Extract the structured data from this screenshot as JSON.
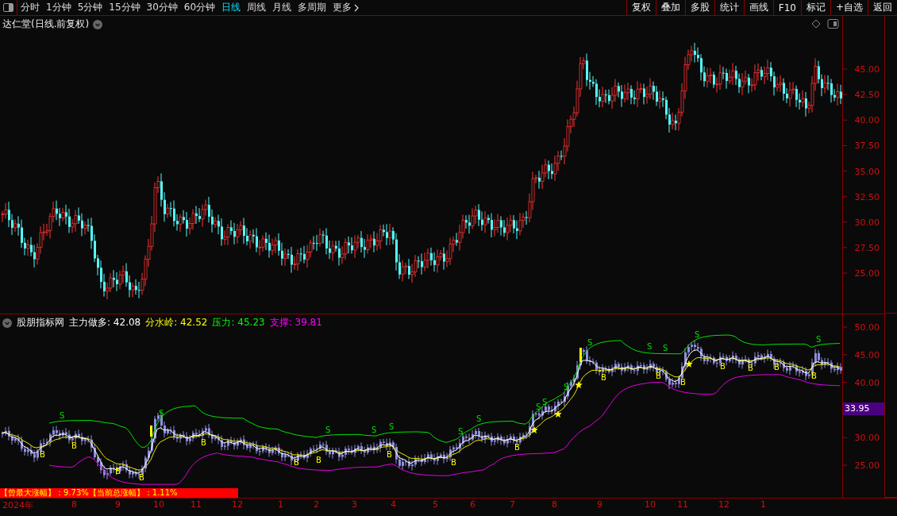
{
  "toolbar": {
    "periods": [
      {
        "label": "分时",
        "selected": false
      },
      {
        "label": "1分钟",
        "selected": false
      },
      {
        "label": "5分钟",
        "selected": false
      },
      {
        "label": "15分钟",
        "selected": false
      },
      {
        "label": "30分钟",
        "selected": false
      },
      {
        "label": "60分钟",
        "selected": false
      },
      {
        "label": "日线",
        "selected": true
      },
      {
        "label": "周线",
        "selected": false
      },
      {
        "label": "月线",
        "selected": false
      },
      {
        "label": "多周期",
        "selected": false
      }
    ],
    "more": "更多",
    "buttons": [
      "复权",
      "叠加",
      "多股",
      "统计",
      "画线",
      "F10",
      "标记",
      "+自选",
      "返回"
    ]
  },
  "price_pane": {
    "title": "达仁堂(日线.前复权)",
    "axis_ticks": [
      "45.00",
      "42.50",
      "40.00",
      "37.50",
      "35.00",
      "32.50",
      "30.00",
      "27.50",
      "25.00"
    ]
  },
  "indicator_pane": {
    "name": "股朋指标网",
    "readings": [
      {
        "label": "主力做多:",
        "value": "42.08",
        "color": "#ffffff"
      },
      {
        "label": "分水岭:",
        "value": "42.52",
        "color": "#ffff00"
      },
      {
        "label": "压力:",
        "value": "45.23",
        "color": "#00ff00"
      },
      {
        "label": "支撑:",
        "value": "39.81",
        "color": "#ff00ff"
      }
    ],
    "axis_ticks": [
      "50.00",
      "45.00",
      "40.00",
      "30.00",
      "25.00"
    ],
    "price_tag": "33.95",
    "buy_signals": [
      {
        "label": "B"
      },
      {
        "label": "B"
      },
      {
        "label": "B"
      },
      {
        "label": "B"
      },
      {
        "label": "B"
      },
      {
        "label": "B"
      },
      {
        "label": "B"
      },
      {
        "label": "B"
      },
      {
        "label": "B"
      },
      {
        "label": "B"
      },
      {
        "label": "B"
      },
      {
        "label": "B"
      },
      {
        "label": "B"
      },
      {
        "label": "B"
      },
      {
        "label": "B"
      },
      {
        "label": "B"
      },
      {
        "label": "B"
      }
    ],
    "sell_signals": [
      {
        "label": "S"
      },
      {
        "label": "S"
      },
      {
        "label": "S"
      },
      {
        "label": "S"
      },
      {
        "label": "S"
      },
      {
        "label": "S"
      },
      {
        "label": "S"
      },
      {
        "label": "S"
      },
      {
        "label": "S"
      },
      {
        "label": "S"
      },
      {
        "label": "S"
      },
      {
        "label": "S"
      },
      {
        "label": "S"
      },
      {
        "label": "S"
      },
      {
        "label": "S"
      }
    ],
    "gain_banner": "【曾最大涨幅】：9.73%【当前总涨幅】：1.11%"
  },
  "time_axis": [
    "2024年",
    "8",
    "9",
    "10",
    "11",
    "12",
    "1",
    "2",
    "3",
    "4",
    "5",
    "6",
    "7",
    "8",
    "9",
    "10",
    "11",
    "12",
    "1"
  ]
}
